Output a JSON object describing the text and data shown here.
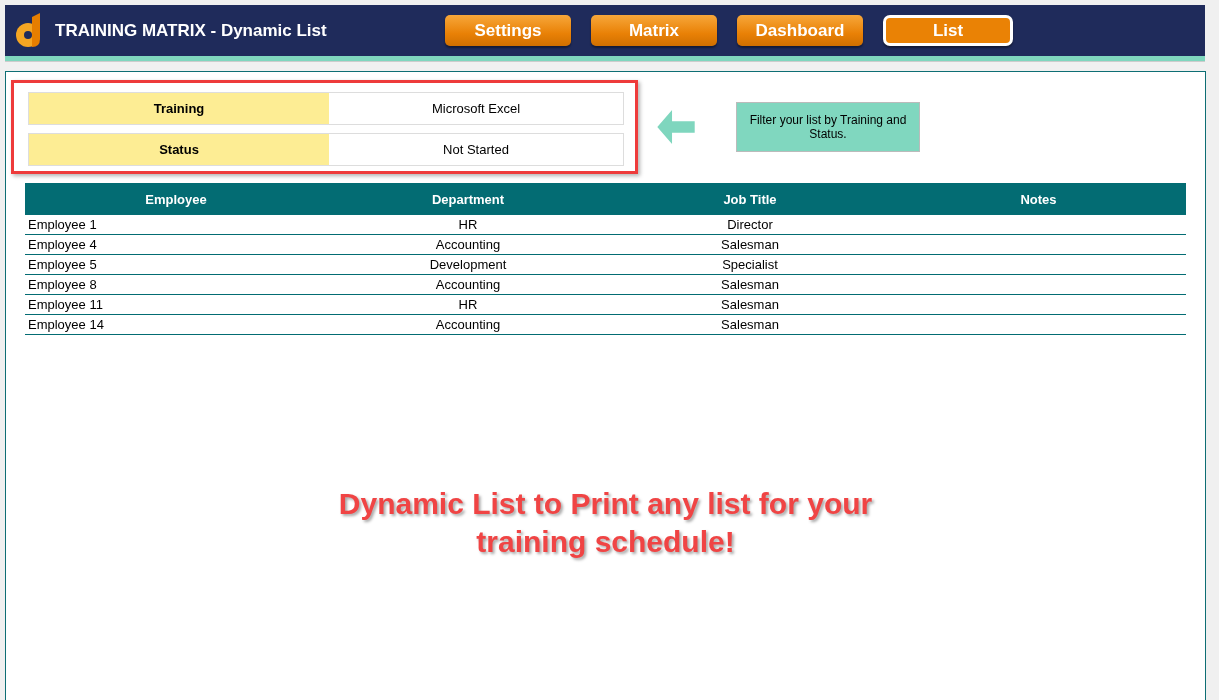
{
  "header": {
    "title": "TRAINING MATRIX - Dynamic List",
    "nav": [
      {
        "label": "Settings",
        "selected": false
      },
      {
        "label": "Matrix",
        "selected": false
      },
      {
        "label": "Dashboard",
        "selected": false
      },
      {
        "label": "List",
        "selected": true
      }
    ]
  },
  "filters": [
    {
      "label": "Training",
      "value": "Microsoft Excel"
    },
    {
      "label": "Status",
      "value": "Not Started"
    }
  ],
  "hint": "Filter your list by Training and Status.",
  "table": {
    "columns": [
      "Employee",
      "Department",
      "Job Title",
      "Notes"
    ],
    "rows": [
      [
        "Employee 1",
        "HR",
        "Director"
      ],
      [
        "Employee 4",
        "Accounting",
        "Salesman"
      ],
      [
        "Employee 5",
        "Development",
        "Specialist"
      ],
      [
        "Employee 8",
        "Accounting",
        "Salesman"
      ],
      [
        "Employee 11",
        "HR",
        "Salesman"
      ],
      [
        "Employee 14",
        "Accounting",
        "Salesman"
      ]
    ]
  },
  "banner": "Dynamic List to Print any list for your training schedule!"
}
